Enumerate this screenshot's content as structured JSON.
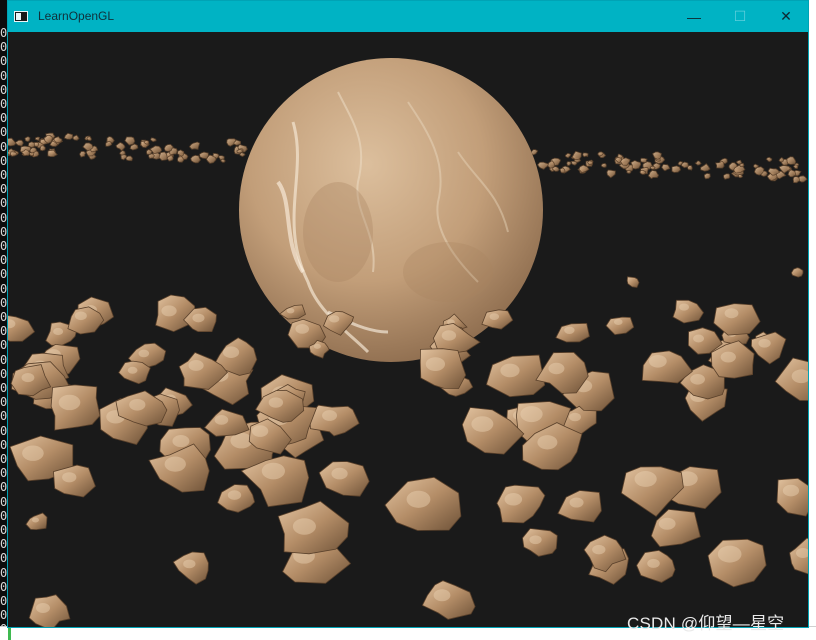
{
  "window": {
    "title": "LearnOpenGL",
    "controls": {
      "minimize": "—",
      "maximize": "☐",
      "close": "✕"
    },
    "frame_color": "#00b3c4",
    "background_color": "#1a1a1a"
  },
  "scene": {
    "objects": [
      "planet",
      "asteroid-ring"
    ],
    "planet_color": "#c7a27f",
    "rock_color": "#b08b66"
  },
  "console": {
    "digit": "0"
  },
  "watermark": "CSDN @仰望—星空"
}
